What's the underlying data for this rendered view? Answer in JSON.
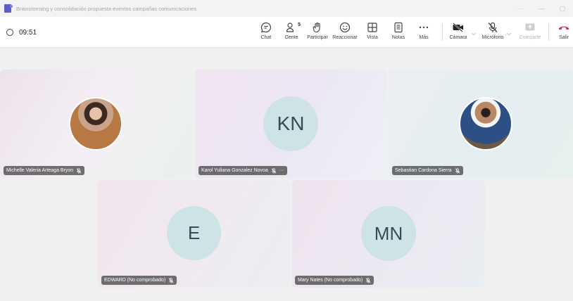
{
  "window": {
    "title": "Brainstorming y consolidación propuesta eventos campañas comunicaciones",
    "controls": [
      "···",
      "—",
      "▢"
    ]
  },
  "call": {
    "time": "09:51",
    "people_count": "5"
  },
  "toolbar": {
    "chat": "Chat",
    "people": "Gente",
    "raise_hand": "Participar",
    "react": "Reaccionar",
    "view": "Vista",
    "notes": "Notas",
    "more": "Más",
    "camera": "Cámara",
    "mic": "Micrófono",
    "share": "Comparte",
    "leave": "Salir"
  },
  "colors": {
    "leave": "#c4314b",
    "brand": "#5b5fc7"
  },
  "participants": [
    {
      "name": "Michelle Valeria Arteaga Bryon",
      "initials": "",
      "avatar": "photo-woman",
      "muted": true
    },
    {
      "name": "Karol Yuliana Gonzalez Novoa",
      "initials": "KN",
      "avatar": "initials",
      "muted": true,
      "more": "···"
    },
    {
      "name": "Sebastian Cardona Sierra",
      "initials": "",
      "avatar": "photo-man",
      "muted": true
    },
    {
      "name": "EDWARD (No comprobado)",
      "initials": "E",
      "avatar": "initials",
      "muted": true
    },
    {
      "name": "Mary Nates (No comprobado)",
      "initials": "MN",
      "avatar": "initials",
      "muted": true
    }
  ]
}
